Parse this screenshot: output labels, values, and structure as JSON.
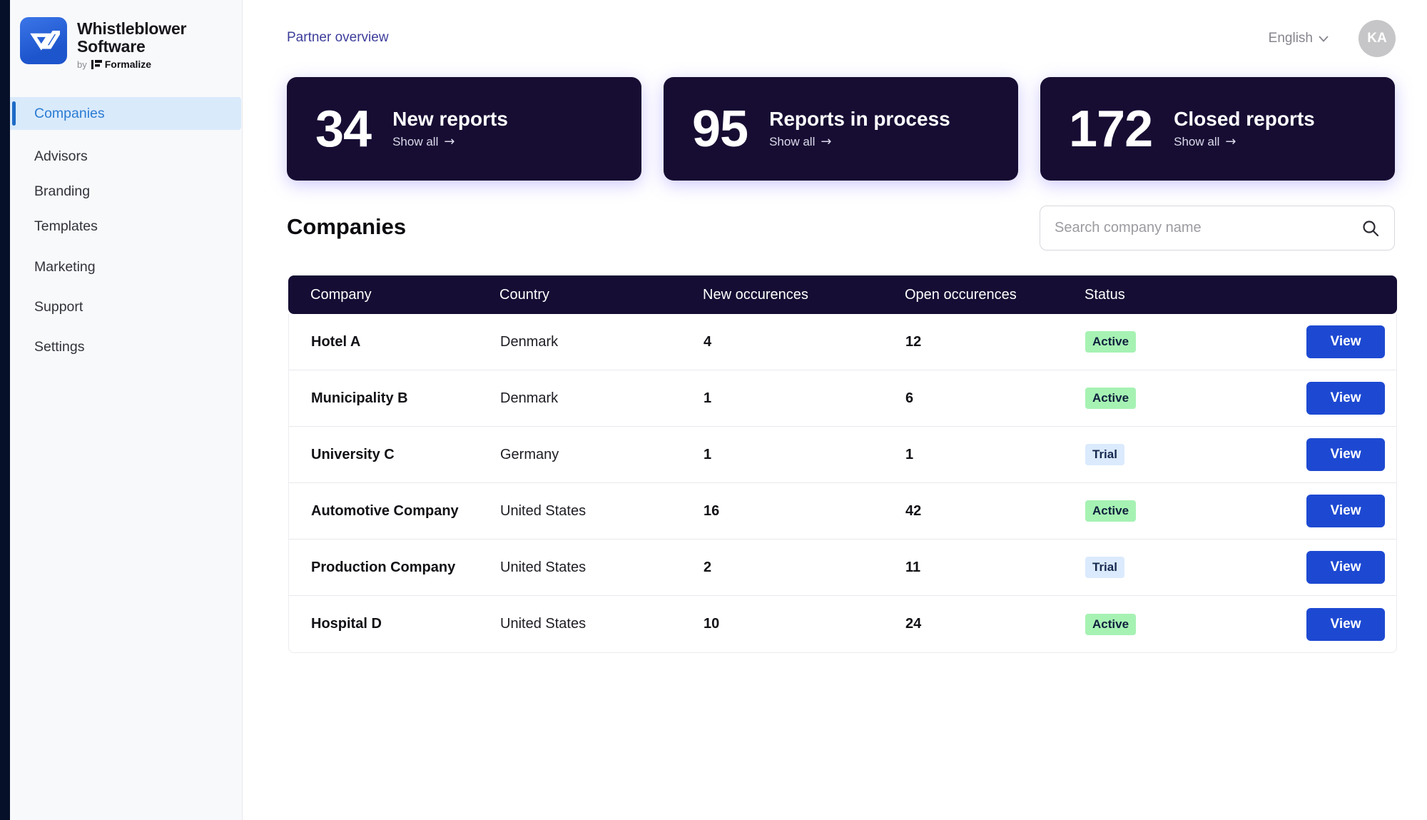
{
  "brand": {
    "name_line1": "Whistleblower",
    "name_line2": "Software",
    "by_label": "by",
    "by_brand": "Formalize"
  },
  "sidebar": {
    "items": [
      {
        "label": "Companies",
        "active": true
      },
      {
        "label": "Advisors",
        "active": false
      },
      {
        "label": "Branding",
        "active": false
      },
      {
        "label": "Templates",
        "active": false
      },
      {
        "label": "Marketing",
        "active": false
      },
      {
        "label": "Support",
        "active": false
      },
      {
        "label": "Settings",
        "active": false
      }
    ]
  },
  "header": {
    "breadcrumb": "Partner overview",
    "language": "English",
    "avatar_initials": "KA"
  },
  "stats": [
    {
      "value": "34",
      "label": "New reports",
      "link": "Show all",
      "arrow": "→"
    },
    {
      "value": "95",
      "label": "Reports in process",
      "link": "Show all",
      "arrow": "→"
    },
    {
      "value": "172",
      "label": "Closed reports",
      "link": "Show all",
      "arrow": "→"
    }
  ],
  "companies_section": {
    "title": "Companies",
    "search_placeholder": "Search company name"
  },
  "table": {
    "columns": [
      "Company",
      "Country",
      "New occurences",
      "Open occurences",
      "Status"
    ],
    "view_label": "View",
    "rows": [
      {
        "company": "Hotel A",
        "country": "Denmark",
        "new": "4",
        "open": "12",
        "status": "Active"
      },
      {
        "company": "Municipality B",
        "country": "Denmark",
        "new": "1",
        "open": "6",
        "status": "Active"
      },
      {
        "company": "University C",
        "country": "Germany",
        "new": "1",
        "open": "1",
        "status": "Trial"
      },
      {
        "company": "Automotive Company",
        "country": "United States",
        "new": "16",
        "open": "42",
        "status": "Active"
      },
      {
        "company": "Production Company",
        "country": "United States",
        "new": "2",
        "open": "11",
        "status": "Trial"
      },
      {
        "company": "Hospital D",
        "country": "United States",
        "new": "10",
        "open": "24",
        "status": "Active"
      }
    ]
  },
  "colors": {
    "card_bg": "#170d33",
    "table_header_bg": "#150d33",
    "button_blue": "#1d49d2",
    "active_badge_bg": "#a6f2b3",
    "trial_badge_bg": "#dbeafd",
    "sidebar_active_bg": "#d9eafb",
    "sidebar_active_text": "#2b7bd3",
    "edge_strip": "#071029",
    "breadcrumb_text": "#3d3d9b"
  }
}
